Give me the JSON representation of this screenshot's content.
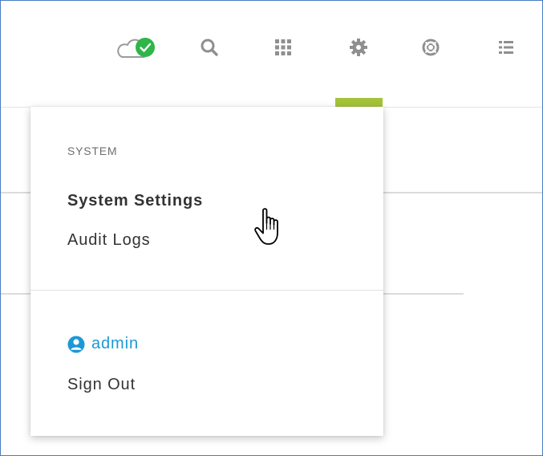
{
  "toolbar": {
    "icons": [
      "cloud-sync-check-icon",
      "search-icon",
      "apps-grid-icon",
      "gear-icon",
      "help-lifebuoy-icon",
      "list-icon"
    ],
    "active_icon": "gear-icon",
    "accent_color": "#a5c23a",
    "status_color": "#2fb54a"
  },
  "settings_menu": {
    "section_label": "SYSTEM",
    "items": [
      {
        "label": "System Settings",
        "hovered": true
      },
      {
        "label": "Audit Logs",
        "hovered": false
      }
    ],
    "user": {
      "name": "admin",
      "icon": "user-avatar-icon",
      "color": "#1c98d6"
    },
    "sign_out_label": "Sign Out"
  },
  "cursor": {
    "type": "pointer-hand-icon"
  }
}
